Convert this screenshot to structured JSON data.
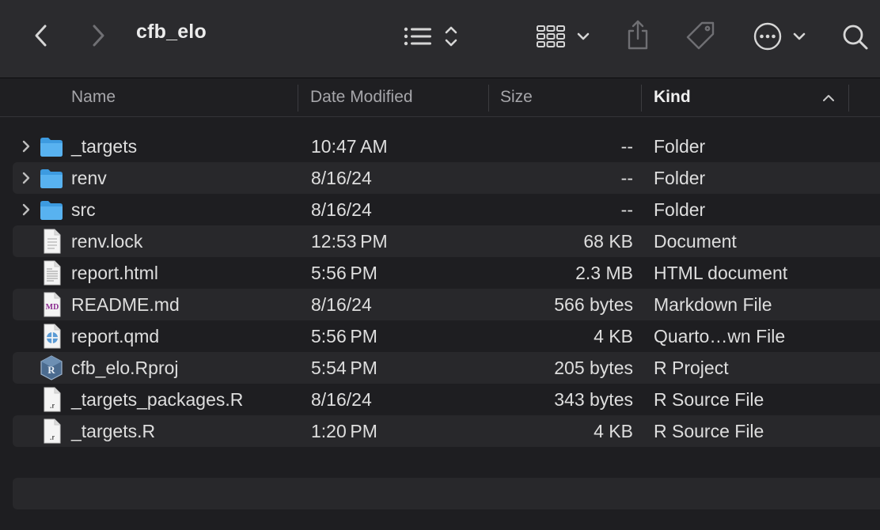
{
  "window": {
    "title": "cfb_elo",
    "colors": {
      "toolbar": "#2b2b2e",
      "background": "#1e1e21",
      "alt_row": "#28282b",
      "folder": "#4aa6e8"
    }
  },
  "toolbar": {
    "icons": [
      "back-chevron-icon",
      "forward-chevron-icon",
      "list-view-icon",
      "sort-updown-icon",
      "grid-view-icon",
      "chevron-down-icon",
      "share-icon",
      "tag-icon",
      "more-icon",
      "chevron-down-icon",
      "search-icon"
    ]
  },
  "columns": {
    "name": "Name",
    "date": "Date Modified",
    "size": "Size",
    "kind": "Kind"
  },
  "files": [
    {
      "name": "_targets",
      "date": "10:47 AM",
      "size": "--",
      "kind": "Folder",
      "icon": "folder-icon",
      "expandable": true
    },
    {
      "name": "renv",
      "date": "8/16/24",
      "size": "--",
      "kind": "Folder",
      "icon": "folder-icon",
      "expandable": true
    },
    {
      "name": "src",
      "date": "8/16/24",
      "size": "--",
      "kind": "Folder",
      "icon": "folder-icon",
      "expandable": true
    },
    {
      "name": "renv.lock",
      "date": "12:53 PM",
      "size": "68 KB",
      "kind": "Document",
      "icon": "document-icon",
      "expandable": false
    },
    {
      "name": "report.html",
      "date": "5:56 PM",
      "size": "2.3 MB",
      "kind": "HTML document",
      "icon": "html-file-icon",
      "expandable": false
    },
    {
      "name": "README.md",
      "date": "8/16/24",
      "size": "566 bytes",
      "kind": "Markdown File",
      "icon": "markdown-file-icon",
      "icon_label": "MD",
      "expandable": false
    },
    {
      "name": "report.qmd",
      "date": "5:56 PM",
      "size": "4 KB",
      "kind": "Quarto…wn File",
      "icon": "quarto-file-icon",
      "expandable": false
    },
    {
      "name": "cfb_elo.Rproj",
      "date": "5:54 PM",
      "size": "205 bytes",
      "kind": "R Project",
      "icon": "rproj-file-icon",
      "icon_label": "R",
      "expandable": false
    },
    {
      "name": "_targets_packages.R",
      "date": "8/16/24",
      "size": "343 bytes",
      "kind": "R Source File",
      "icon": "r-source-file-icon",
      "icon_label": ".r",
      "expandable": false
    },
    {
      "name": "_targets.R",
      "date": "1:20 PM",
      "size": "4 KB",
      "kind": "R Source File",
      "icon": "r-source-file-icon",
      "icon_label": ".r",
      "expandable": false
    }
  ]
}
